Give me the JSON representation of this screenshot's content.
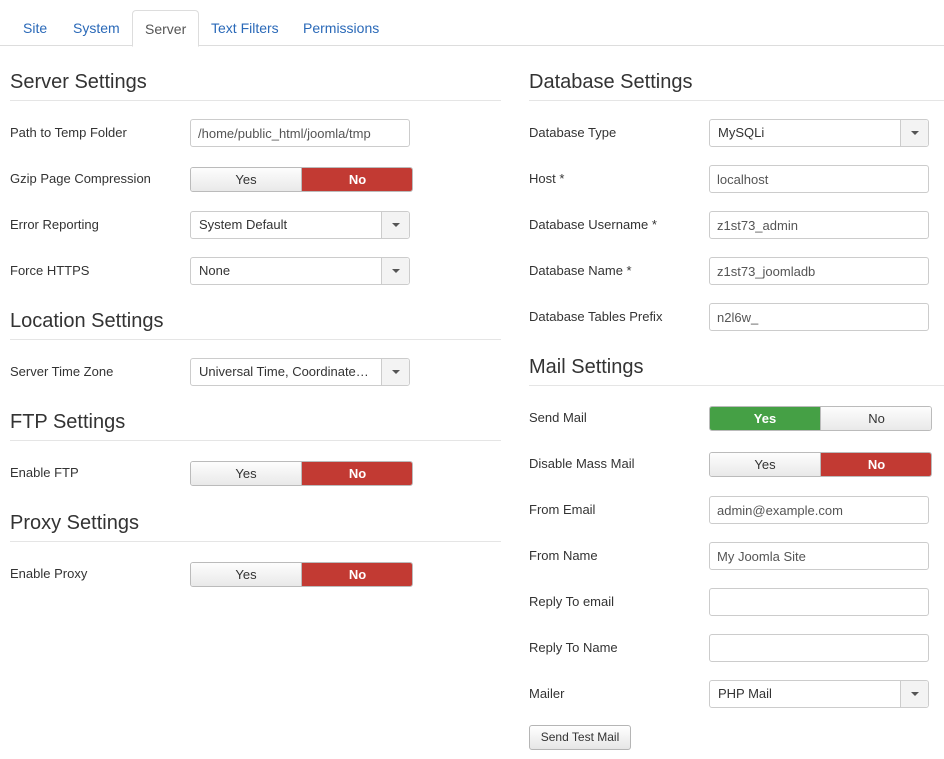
{
  "tabs": [
    {
      "label": "Site"
    },
    {
      "label": "System"
    },
    {
      "label": "Server"
    },
    {
      "label": "Text Filters"
    },
    {
      "label": "Permissions"
    }
  ],
  "active_tab": "Server",
  "server": {
    "title": "Server Settings",
    "temp_path_label": "Path to Temp Folder",
    "temp_path_value": "/home/public_html/joomla/tmp",
    "gzip_label": "Gzip Page Compression",
    "gzip_yes": "Yes",
    "gzip_no": "No",
    "gzip_value": "No",
    "error_label": "Error Reporting",
    "error_value": "System Default",
    "https_label": "Force HTTPS",
    "https_value": "None"
  },
  "location": {
    "title": "Location Settings",
    "timezone_label": "Server Time Zone",
    "timezone_value": "Universal Time, Coordinated (UTC)"
  },
  "ftp": {
    "title": "FTP Settings",
    "enable_label": "Enable FTP",
    "yes": "Yes",
    "no": "No",
    "value": "No"
  },
  "proxy": {
    "title": "Proxy Settings",
    "enable_label": "Enable Proxy",
    "yes": "Yes",
    "no": "No",
    "value": "No"
  },
  "database": {
    "title": "Database Settings",
    "type_label": "Database Type",
    "type_value": "MySQLi",
    "host_label": "Host *",
    "host_value": "localhost",
    "user_label": "Database Username *",
    "user_value": "z1st73_admin",
    "name_label": "Database Name *",
    "name_value": "z1st73_joomladb",
    "prefix_label": "Database Tables Prefix",
    "prefix_value": "n2l6w_"
  },
  "mail": {
    "title": "Mail Settings",
    "send_label": "Send Mail",
    "send_yes": "Yes",
    "send_no": "No",
    "send_value": "Yes",
    "mass_label": "Disable Mass Mail",
    "mass_yes": "Yes",
    "mass_no": "No",
    "mass_value": "No",
    "from_email_label": "From Email",
    "from_email_value": "admin@example.com",
    "from_name_label": "From Name",
    "from_name_value": "My Joomla Site",
    "reply_email_label": "Reply To email",
    "reply_email_value": "",
    "reply_name_label": "Reply To Name",
    "reply_name_value": "",
    "mailer_label": "Mailer",
    "mailer_value": "PHP Mail",
    "test_button": "Send Test Mail"
  },
  "colors": {
    "link": "#2a69b8",
    "toggle_no": "#c23a33",
    "toggle_yes": "#45a045"
  }
}
